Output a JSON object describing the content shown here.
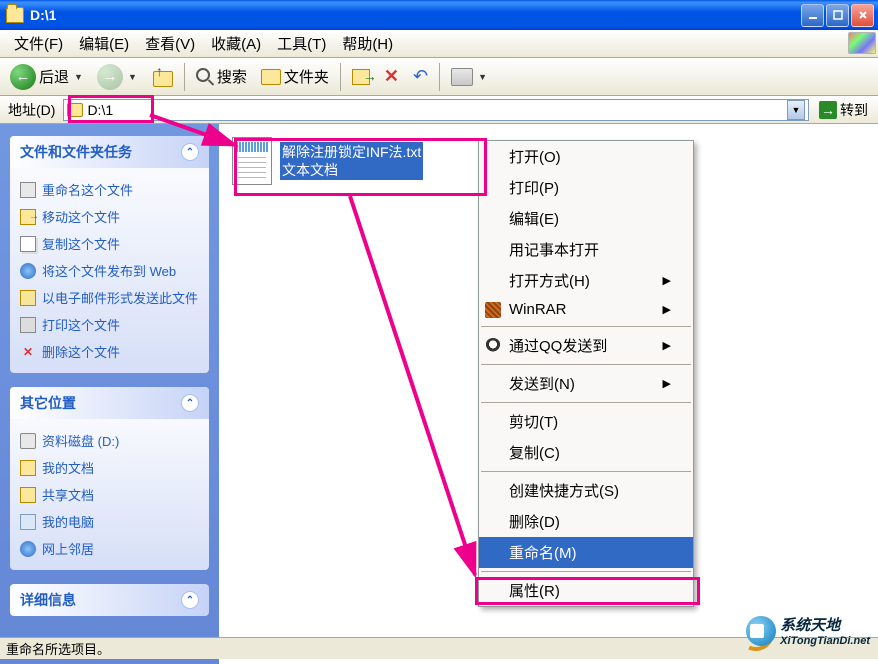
{
  "window": {
    "title": "D:\\1"
  },
  "menubar": {
    "file": "文件(F)",
    "edit": "编辑(E)",
    "view": "查看(V)",
    "favorites": "收藏(A)",
    "tools": "工具(T)",
    "help": "帮助(H)"
  },
  "toolbar": {
    "back": "后退",
    "search": "搜索",
    "folders": "文件夹"
  },
  "address": {
    "label": "地址(D)",
    "path": "D:\\1",
    "go": "转到"
  },
  "sidebar": {
    "tasks": {
      "title": "文件和文件夹任务",
      "items": [
        "重命名这个文件",
        "移动这个文件",
        "复制这个文件",
        "将这个文件发布到 Web",
        "以电子邮件形式发送此文件",
        "打印这个文件",
        "删除这个文件"
      ]
    },
    "places": {
      "title": "其它位置",
      "items": [
        "资料磁盘 (D:)",
        "我的文档",
        "共享文档",
        "我的电脑",
        "网上邻居"
      ]
    },
    "details": {
      "title": "详细信息"
    }
  },
  "file": {
    "name": "解除注册锁定INF法.txt",
    "type": "文本文档"
  },
  "context_menu": {
    "open": "打开(O)",
    "print": "打印(P)",
    "edit": "编辑(E)",
    "open_notepad": "用记事本打开",
    "open_with": "打开方式(H)",
    "winrar": "WinRAR",
    "qq_send": "通过QQ发送到",
    "send_to": "发送到(N)",
    "cut": "剪切(T)",
    "copy": "复制(C)",
    "shortcut": "创建快捷方式(S)",
    "delete": "删除(D)",
    "rename": "重命名(M)",
    "properties": "属性(R)"
  },
  "statusbar": {
    "text": "重命名所选项目。"
  },
  "watermark": {
    "text1": "系统天地",
    "text2": "XiTongTianDi.net"
  }
}
